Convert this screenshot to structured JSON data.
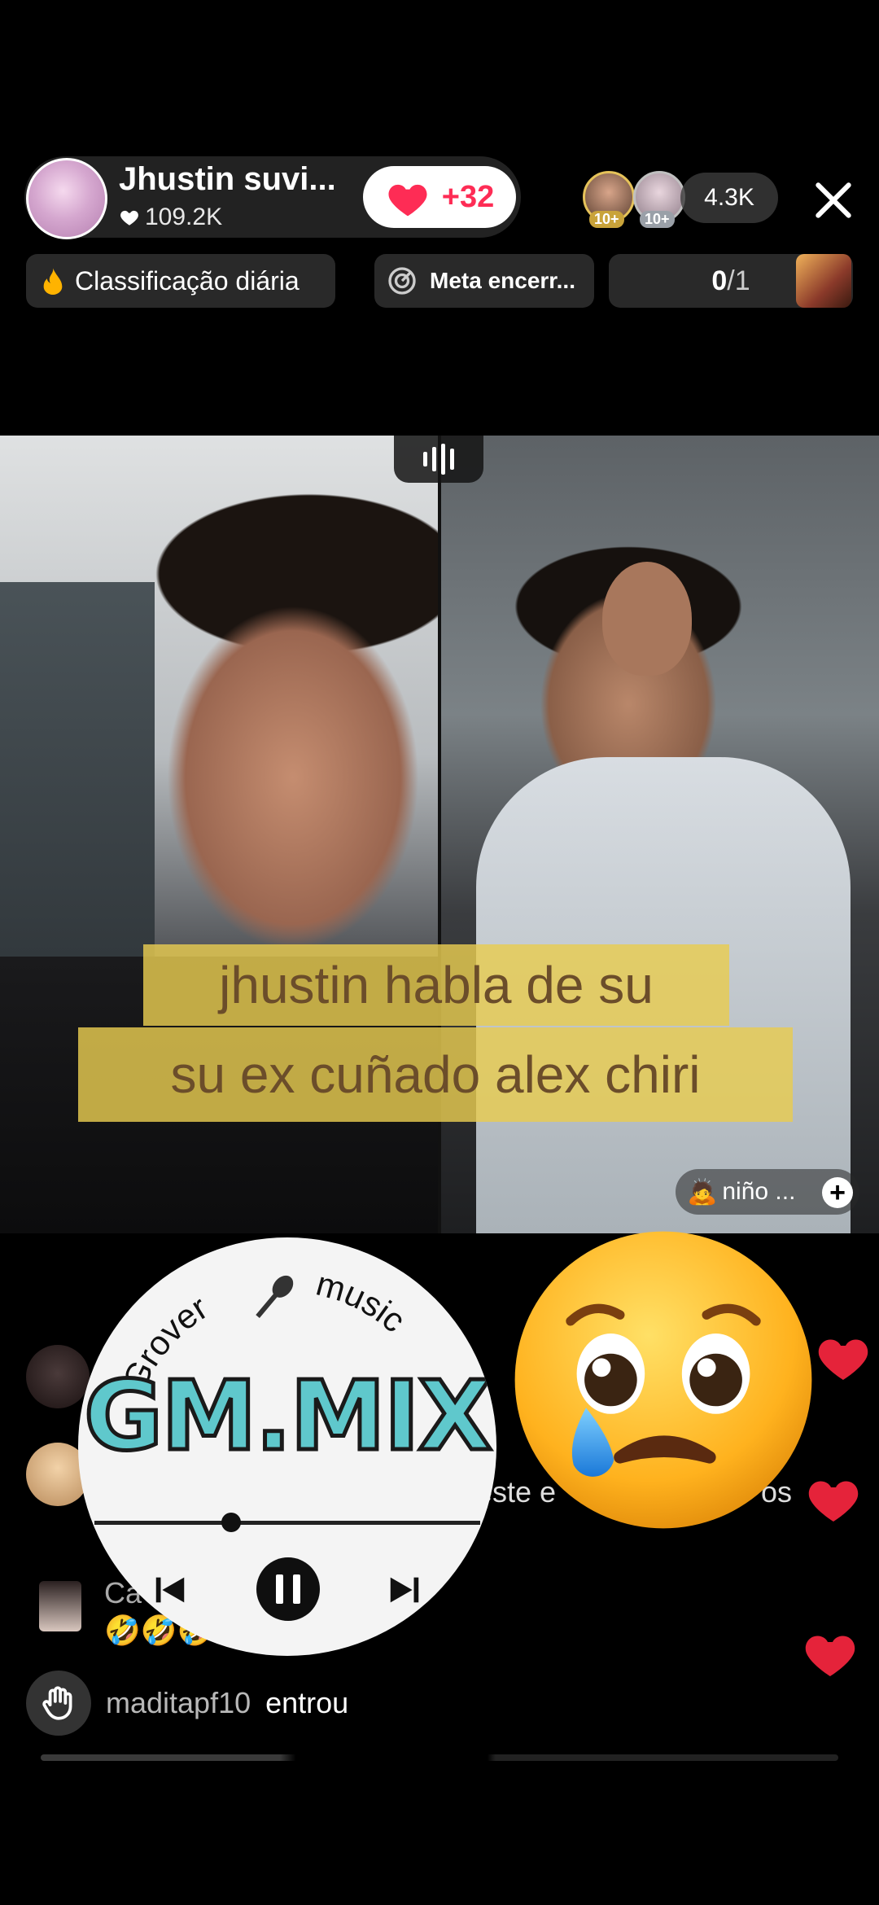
{
  "header": {
    "host_name": "Jhustin suvi...",
    "host_likes": "109.2K",
    "gift_count": "+32",
    "viewer_badges": [
      "10+",
      "10+"
    ],
    "viewer_count": "4.3K",
    "ranking_label": "Classificação diária",
    "goal_label": "Meta encerr...",
    "score_value": "0",
    "score_total": "/1"
  },
  "video": {
    "caption_line1": "jhustin habla de su",
    "caption_line2": "su ex cuñado alex chiri",
    "guest_name": "niño ...",
    "guest_emoji": "🙇"
  },
  "overlay": {
    "brand_left": "Grover",
    "brand_right": "music",
    "logo_text": "GM.MIX"
  },
  "comments": [
    {
      "name": "",
      "text": ""
    },
    {
      "name": "",
      "text": "este e",
      "text_tail": "os"
    },
    {
      "name": "Ca",
      "text": "🤣🤣🤣🤣🤣🤣"
    }
  ],
  "joined": {
    "user": "maditapf10",
    "action": "entrou"
  },
  "colors": {
    "accent_red": "#fe2c55",
    "caption_bg": "#e8cc50",
    "caption_text": "#6b4d2a",
    "logo_teal": "#5fc8cc"
  }
}
